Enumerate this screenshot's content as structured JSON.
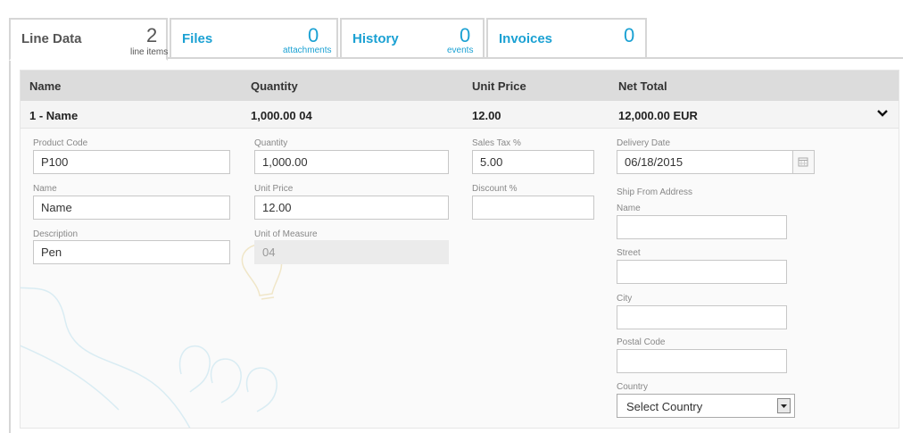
{
  "tabs": [
    {
      "label": "Line Data",
      "count": "2",
      "sub": "line items"
    },
    {
      "label": "Files",
      "count": "0",
      "sub": "attachments"
    },
    {
      "label": "History",
      "count": "0",
      "sub": "events"
    },
    {
      "label": "Invoices",
      "count": "0",
      "sub": ""
    }
  ],
  "table": {
    "headers": [
      "Name",
      "Quantity",
      "Unit Price",
      "Net Total"
    ],
    "row": {
      "name": "1 - Name",
      "quantity": "1,000.00 04",
      "unit_price": "12.00",
      "net_total": "12,000.00 EUR"
    }
  },
  "form": {
    "product_code": {
      "label": "Product Code",
      "value": "P100"
    },
    "name": {
      "label": "Name",
      "value": "Name"
    },
    "description": {
      "label": "Description",
      "value": "Pen"
    },
    "quantity": {
      "label": "Quantity",
      "value": "1,000.00"
    },
    "unit_price": {
      "label": "Unit Price",
      "value": "12.00"
    },
    "unit_of_measure": {
      "label": "Unit of Measure",
      "value": "04"
    },
    "sales_tax": {
      "label": "Sales Tax %",
      "value": "5.00"
    },
    "discount": {
      "label": "Discount %",
      "value": ""
    },
    "delivery_date": {
      "label": "Delivery Date",
      "value": "06/18/2015"
    },
    "ship_from": {
      "title": "Ship From Address",
      "name_label": "Name",
      "street_label": "Street",
      "city_label": "City",
      "postal_label": "Postal Code",
      "country_label": "Country",
      "country_value": "Select Country"
    }
  },
  "icons": {
    "row_toggle": "chevron-down-icon",
    "calendar": "calendar-icon",
    "dropdown": "dropdown-arrow-icon"
  },
  "colors": {
    "accent": "#1ba1d3",
    "header_bg": "#dcdcdc"
  }
}
